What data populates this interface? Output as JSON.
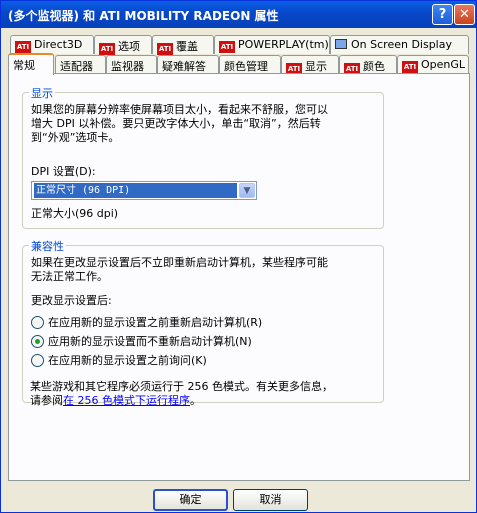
{
  "window": {
    "title": "(多个监视器) 和 ATI MOBILITY RADEON 属性",
    "help_glyph": "?",
    "close_glyph": "✕"
  },
  "tabs_row1": [
    {
      "label": "Direct3D",
      "icon": "ati-logo-icon"
    },
    {
      "label": "选项",
      "icon": "ati-logo-icon"
    },
    {
      "label": "覆盖",
      "icon": "ati-logo-icon"
    },
    {
      "label": "POWERPLAY(tm)",
      "icon": "ati-logo-icon"
    },
    {
      "label": "On Screen Display",
      "icon": "monitor-icon"
    }
  ],
  "tabs_row2": [
    {
      "label": "常规",
      "active": true
    },
    {
      "label": "适配器"
    },
    {
      "label": "监视器"
    },
    {
      "label": "疑难解答"
    },
    {
      "label": "颜色管理"
    },
    {
      "label": "显示",
      "icon": "ati-logo-icon"
    },
    {
      "label": "颜色",
      "icon": "ati-logo-icon"
    },
    {
      "label": "OpenGL",
      "icon": "ati-logo-icon"
    }
  ],
  "ati_mark": "ATI",
  "display_group": {
    "legend": "显示",
    "desc_line1": "如果您的屏幕分辨率使屏幕项目太小，看起来不舒服，您可以",
    "desc_line2": "增大 DPI 以补偿。要只更改字体大小，单击“取消”，然后转",
    "desc_line3": "到“外观”选项卡。",
    "dpi_label": "DPI 设置(D):",
    "dpi_selected": "正常尺寸 (96 DPI)",
    "dpi_arrow": "▼",
    "dpi_caption": "正常大小(96 dpi)"
  },
  "compat_group": {
    "legend": "兼容性",
    "desc_line1": "如果在更改显示设置后不立即重新启动计算机，某些程序可能",
    "desc_line2": "无法正常工作。",
    "after_label": "更改显示设置后:",
    "options": [
      {
        "label": "在应用新的显示设置之前重新启动计算机(R)",
        "checked": false
      },
      {
        "label": "应用新的显示设置而不重新启动计算机(N)",
        "checked": true
      },
      {
        "label": "在应用新的显示设置之前询问(K)",
        "checked": false
      }
    ],
    "note_line1": "某些游戏和其它程序必须运行于 256 色模式。有关更多信息，",
    "note_prefix": "请参阅",
    "note_link": "在 256 色模式下运行程序",
    "note_suffix": "。"
  },
  "buttons": {
    "ok": "确定",
    "cancel": "取消"
  }
}
